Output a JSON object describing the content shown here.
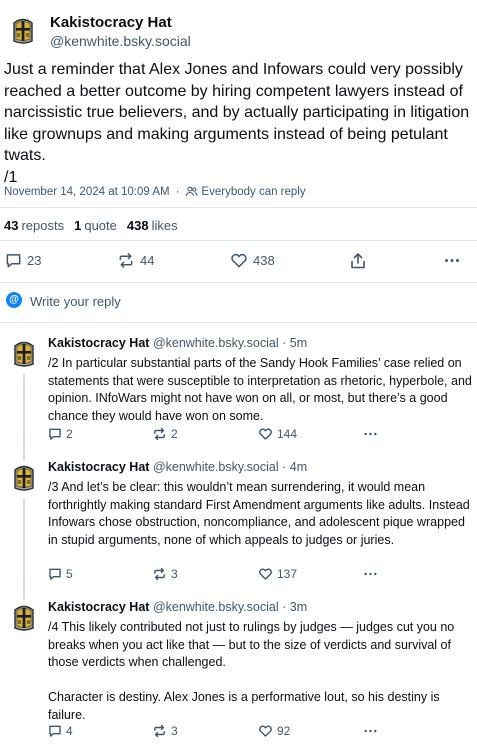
{
  "main_post": {
    "author_name": "Kakistocracy Hat",
    "author_handle": "@kenwhite.bsky.social",
    "text": "Just a reminder that Alex Jones and Infowars could very possibly reached a better outcome by hiring competent lawyers instead of narcissistic true believers, and by actually participating in litigation like grownups and making arguments instead of being petulant twats.\n/1",
    "timestamp": "November 14, 2024 at 10:09 AM",
    "separator": "·",
    "visibility": "Everybody can reply",
    "stats": {
      "reposts_count": "43",
      "reposts_label": "reposts",
      "quotes_count": "1",
      "quotes_label": "quote",
      "likes_count": "438",
      "likes_label": "likes"
    },
    "actions": {
      "replies": "23",
      "reposts": "44",
      "likes": "438"
    }
  },
  "reply_box": {
    "placeholder": "Write your reply",
    "icon": "at-sign-icon"
  },
  "replies": [
    {
      "author_name": "Kakistocracy Hat",
      "author_handle": "@kenwhite.bsky.social",
      "time": "· 5m",
      "text": "/2 In particular substantial parts of the Sandy Hook Families’ case relied on statements that were susceptible to interpretation as rhetoric, hyperbole, and opinion.  INfoWars might not have won on all, or most, but there’s a good chance they would have won on some.",
      "replies": "2",
      "reposts": "2",
      "likes": "144"
    },
    {
      "author_name": "Kakistocracy Hat",
      "author_handle": "@kenwhite.bsky.social",
      "time": "· 4m",
      "text": "/3 And let’s be clear:  this wouldn’t mean surrendering, it would mean forthrightly making standard First Amendment arguments like adults. Instead Infowars chose obstruction, noncompliance, and adolescent pique wrapped in stupid arguments, none of which appeals to judges or juries.",
      "replies": "5",
      "reposts": "3",
      "likes": "137"
    },
    {
      "author_name": "Kakistocracy Hat",
      "author_handle": "@kenwhite.bsky.social",
      "time": "· 3m",
      "text": "/4 This likely contributed not just to rulings by judges — judges cut you no breaks when you act like that — but to the size of verdicts and survival of those verdicts when challenged.\n\nCharacter is destiny.  Alex Jones is a performative lout, so his destiny is failure.",
      "replies": "4",
      "reposts": "3",
      "likes": "92"
    }
  ],
  "colors": {
    "text": "#0b0f14",
    "muted": "#42576c",
    "accent": "#1083fe",
    "divider": "#e3e8ee",
    "avatar_gold": "#d9b23a",
    "avatar_cross": "#1f1f1f"
  }
}
